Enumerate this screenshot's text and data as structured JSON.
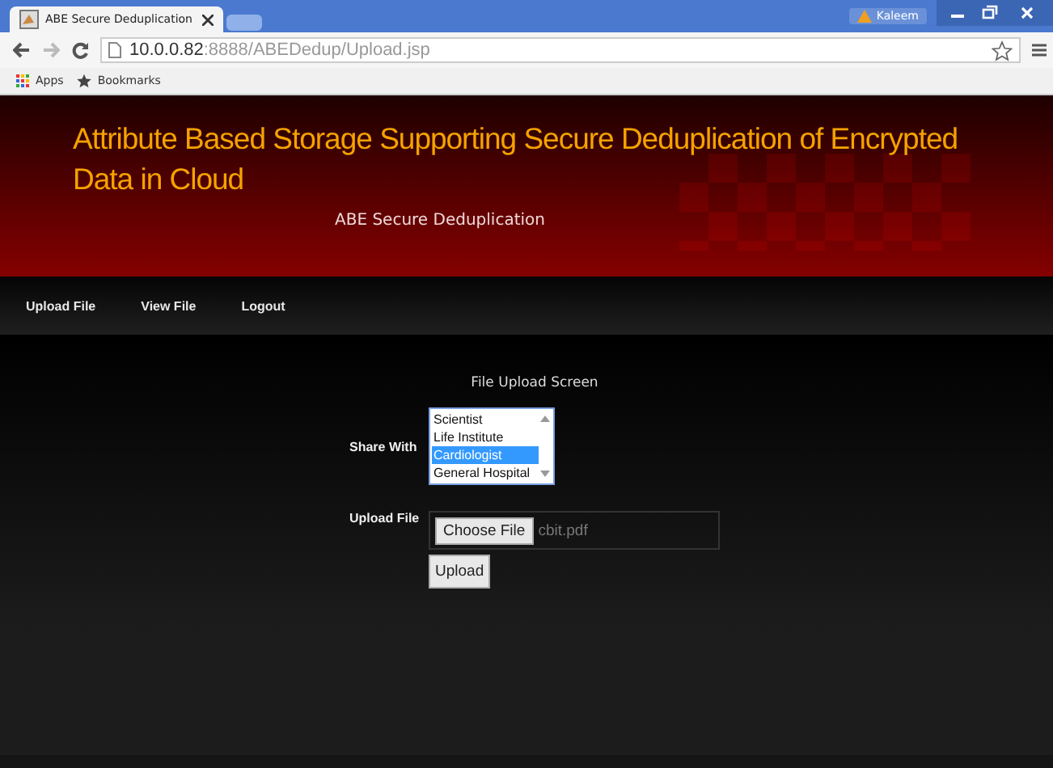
{
  "browser": {
    "tab_title": "ABE Secure Deduplication",
    "profile": "Kaleem",
    "url_host": "10.0.0.82",
    "url_rest": ":8888/ABEDedup/Upload.jsp",
    "bookmarks": [
      {
        "label": "Apps",
        "kind": "apps"
      },
      {
        "label": "Bookmarks",
        "kind": "star"
      }
    ]
  },
  "header": {
    "title": "Attribute Based Storage Supporting Secure Deduplication of Encrypted Data in Cloud",
    "subtitle": "ABE Secure Deduplication"
  },
  "nav": [
    "Upload File",
    "View File",
    "Logout"
  ],
  "form": {
    "heading": "File Upload Screen",
    "share_label": "Share With",
    "share_options": [
      {
        "label": "Scientist",
        "selected": false
      },
      {
        "label": "Life Institute",
        "selected": false
      },
      {
        "label": "Cardiologist",
        "selected": true
      },
      {
        "label": "General Hospital",
        "selected": false
      }
    ],
    "upload_label": "Upload File",
    "choose_button": "Choose File",
    "file_name": "cbit.pdf",
    "submit": "Upload"
  }
}
